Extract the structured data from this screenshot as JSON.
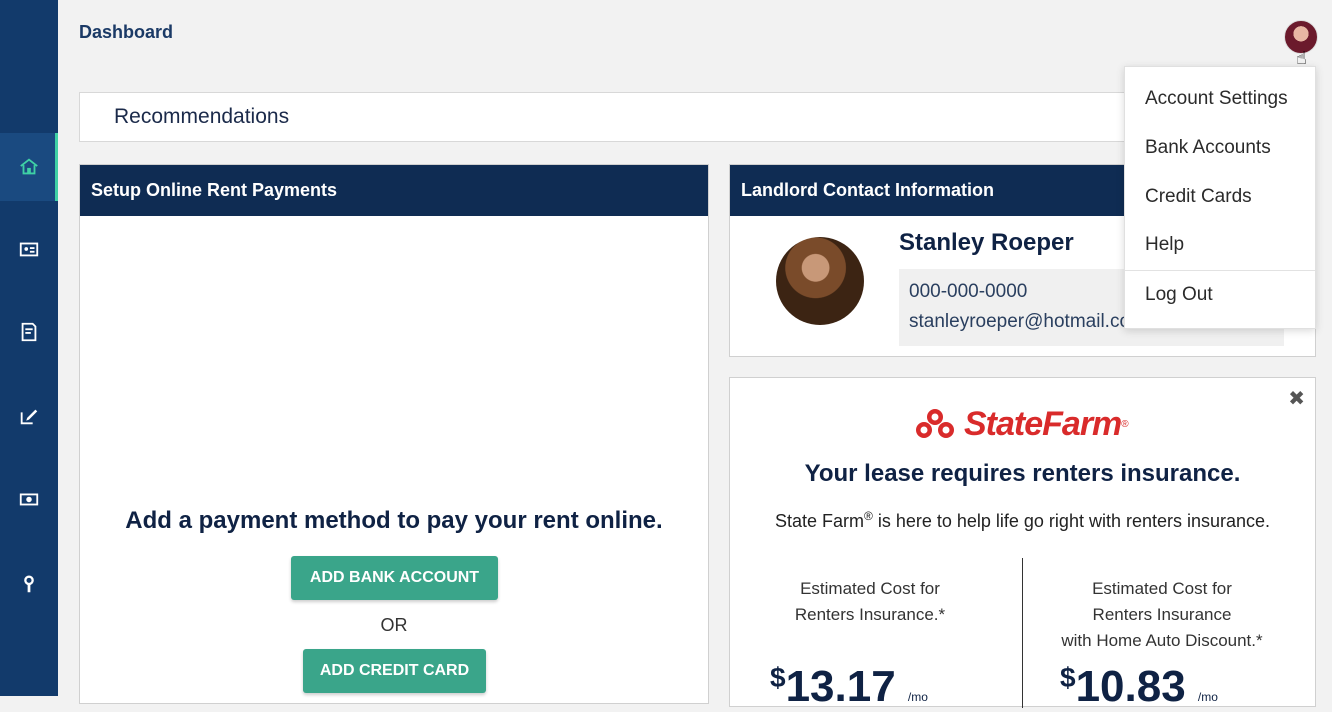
{
  "header": {
    "title": "Dashboard"
  },
  "sidebar": {
    "items": [
      {
        "icon": "home-icon",
        "active": true
      },
      {
        "icon": "id-card-icon",
        "active": false
      },
      {
        "icon": "document-icon",
        "active": false
      },
      {
        "icon": "edit-icon",
        "active": false
      },
      {
        "icon": "money-icon",
        "active": false
      },
      {
        "icon": "wrench-icon",
        "active": false
      }
    ]
  },
  "recommendations": {
    "title": "Recommendations"
  },
  "rent_card": {
    "title": "Setup Online Rent Payments",
    "prompt": "Add a payment method to pay your rent online.",
    "add_bank_label": "ADD BANK ACCOUNT",
    "or_label": "OR",
    "add_card_label": "ADD CREDIT CARD"
  },
  "landlord_card": {
    "title": "Landlord Contact Information",
    "name": "Stanley Roeper",
    "phone": "000-000-0000",
    "email": "stanleyroeper@hotmail.com"
  },
  "insurance_card": {
    "close_label": "✖",
    "brand": "StateFarm",
    "brand_reg": "®",
    "headline": "Your lease requires renters insurance.",
    "sub_brand": "State Farm",
    "sub_reg": "®",
    "sub_text": " is here to help life go right with renters insurance.",
    "left_line1": "Estimated Cost for",
    "left_line2": "Renters Insurance.*",
    "right_line1": "Estimated Cost for",
    "right_line2": "Renters Insurance",
    "right_line3": "with Home Auto Discount.*",
    "currency": "$",
    "price_left": "13.17",
    "price_right": "10.83",
    "per": "/mo"
  },
  "dropdown": {
    "items": [
      "Account Settings",
      "Bank Accounts",
      "Credit Cards",
      "Help",
      "Log Out"
    ]
  },
  "colors": {
    "sidebar": "#123a6b",
    "header_dark": "#0f2c53",
    "accent_green": "#3aa58a",
    "brand_red": "#d92b2b"
  }
}
